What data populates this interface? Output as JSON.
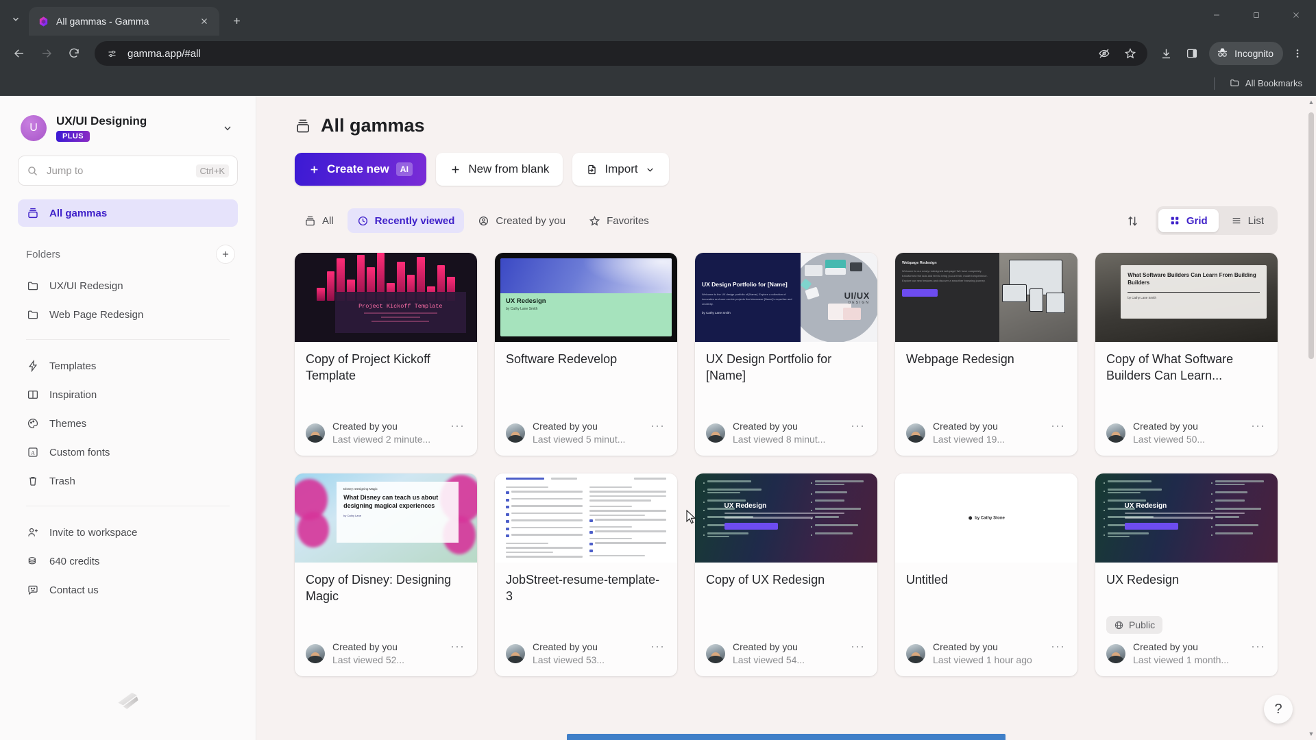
{
  "browser": {
    "tab": {
      "title": "All gammas - Gamma",
      "favicon": "gamma-logo-icon",
      "close": "×"
    },
    "new_tab_label": "+",
    "url": "gamma.app/#all",
    "profile_chip": "Incognito",
    "bookmarks_label": "All Bookmarks",
    "toolbar_icons": [
      "back-arrow",
      "forward-arrow",
      "reload",
      "site-settings",
      "eye-off",
      "bookmark-star",
      "download",
      "side-panel",
      "incognito",
      "kebab-menu"
    ],
    "window_controls": [
      "minimize",
      "maximize",
      "close"
    ]
  },
  "sidebar": {
    "workspace": {
      "initial": "U",
      "name": "UX/UI Designing",
      "plan_badge": "PLUS"
    },
    "search": {
      "placeholder": "Jump to",
      "shortcut": "Ctrl+K"
    },
    "primary": [
      {
        "label": "All gammas",
        "icon": "gamma-stack-icon",
        "active": true
      }
    ],
    "folders_header": "Folders",
    "folders": [
      {
        "label": "UX/UI Redesign",
        "icon": "folder-icon"
      },
      {
        "label": "Web Page Redesign",
        "icon": "folder-icon"
      }
    ],
    "nav": [
      {
        "label": "Templates",
        "icon": "lightning-icon"
      },
      {
        "label": "Inspiration",
        "icon": "book-open-icon"
      },
      {
        "label": "Themes",
        "icon": "palette-icon"
      },
      {
        "label": "Custom fonts",
        "icon": "font-icon"
      },
      {
        "label": "Trash",
        "icon": "trash-icon"
      }
    ],
    "footer": [
      {
        "label": "Invite to workspace",
        "icon": "user-plus-icon"
      },
      {
        "label": "640 credits",
        "icon": "coins-icon"
      },
      {
        "label": "Contact us",
        "icon": "chat-smile-icon"
      }
    ]
  },
  "main": {
    "title": "All gammas",
    "title_icon": "gamma-stack-icon",
    "actions": [
      {
        "label": "Create new",
        "badge": "AI",
        "icon": "plus-icon",
        "style": "primary"
      },
      {
        "label": "New from blank",
        "icon": "plus-icon",
        "style": "white"
      },
      {
        "label": "Import",
        "icon": "import-icon",
        "chevron": "chevron-down-icon",
        "style": "white"
      }
    ],
    "filters": [
      {
        "label": "All",
        "icon": "gamma-stack-icon",
        "active": false
      },
      {
        "label": "Recently viewed",
        "icon": "clock-icon",
        "active": true
      },
      {
        "label": "Created by you",
        "icon": "user-circle-icon",
        "active": false
      },
      {
        "label": "Favorites",
        "icon": "star-icon",
        "active": false
      }
    ],
    "sort_icon": "sort-arrows-icon",
    "views": [
      {
        "label": "Grid",
        "icon": "grid-icon",
        "active": true
      },
      {
        "label": "List",
        "icon": "list-icon",
        "active": false
      }
    ],
    "help_label": "?"
  },
  "cards": [
    {
      "title": "Copy of Project Kickoff Template",
      "created_by": "Created by you",
      "last_viewed": "Last viewed 2 minute...",
      "menu": "···",
      "thumb": "kickoff",
      "thumb_text": {
        "heading": "Project Kickoff Template"
      }
    },
    {
      "title": "Software Redevelop",
      "created_by": "Created by you",
      "last_viewed": "Last viewed 5 minut...",
      "menu": "···",
      "thumb": "software",
      "thumb_text": {
        "heading": "UX Redesign",
        "sub": "by Cathy Lane Smith"
      }
    },
    {
      "title": "UX Design Portfolio for [Name]",
      "created_by": "Created by you",
      "last_viewed": "Last viewed 8 minut...",
      "menu": "···",
      "thumb": "portfolio",
      "thumb_text": {
        "heading": "UX Design Portfolio for [Name]",
        "sub": "by Cathy Lane Smith",
        "brand": "UI/UX",
        "brand_sub": "DESIGN"
      }
    },
    {
      "title": "Webpage Redesign",
      "created_by": "Created by you",
      "last_viewed": "Last viewed 19...",
      "menu": "···",
      "thumb": "webpage",
      "thumb_text": {
        "heading": "Webpage Redesign"
      }
    },
    {
      "title": "Copy of What Software Builders Can Learn...",
      "created_by": "Created by you",
      "last_viewed": "Last viewed 50...",
      "menu": "···",
      "thumb": "builders",
      "thumb_text": {
        "heading": "What Software Builders Can Learn From Building Builders",
        "sub": "by Cathy Lane Smith"
      }
    },
    {
      "title": "Copy of Disney: Designing Magic",
      "created_by": "Created by you",
      "last_viewed": "Last viewed 52...",
      "menu": "···",
      "thumb": "disney",
      "thumb_text": {
        "kicker": "Disney: Designing Magic",
        "heading": "What Disney can teach us about designing magical experiences",
        "sub": "by Cathy Lane"
      }
    },
    {
      "title": "JobStreet-resume-template-3",
      "created_by": "Created by you",
      "last_viewed": "Last viewed 53...",
      "menu": "···",
      "thumb": "resume",
      "thumb_text": {}
    },
    {
      "title": "Copy of UX Redesign",
      "created_by": "Created by you",
      "last_viewed": "Last viewed 54...",
      "menu": "···",
      "thumb": "uxredesign",
      "thumb_text": {
        "heading": "UX Redesign"
      }
    },
    {
      "title": "Untitled",
      "created_by": "Created by you",
      "last_viewed": "Last viewed 1 hour ago",
      "menu": "···",
      "thumb": "untitled",
      "thumb_text": {
        "sub": "by Cathy Stone"
      }
    },
    {
      "title": "UX Redesign",
      "created_by": "Created by you",
      "last_viewed": "Last viewed 1 month...",
      "menu": "···",
      "thumb": "uxredesign",
      "badge": {
        "label": "Public",
        "icon": "globe-icon"
      },
      "thumb_text": {
        "heading": "UX Redesign"
      }
    }
  ],
  "colors": {
    "accent": "#3f21c9",
    "accent_soft": "#e6e3fb",
    "primary_gradient_from": "#3b1ad4",
    "primary_gradient_to": "#7a2cd6",
    "page_bg": "#f7f2f1",
    "sidebar_bg": "#fbfafa",
    "chrome_bg": "#323639"
  }
}
